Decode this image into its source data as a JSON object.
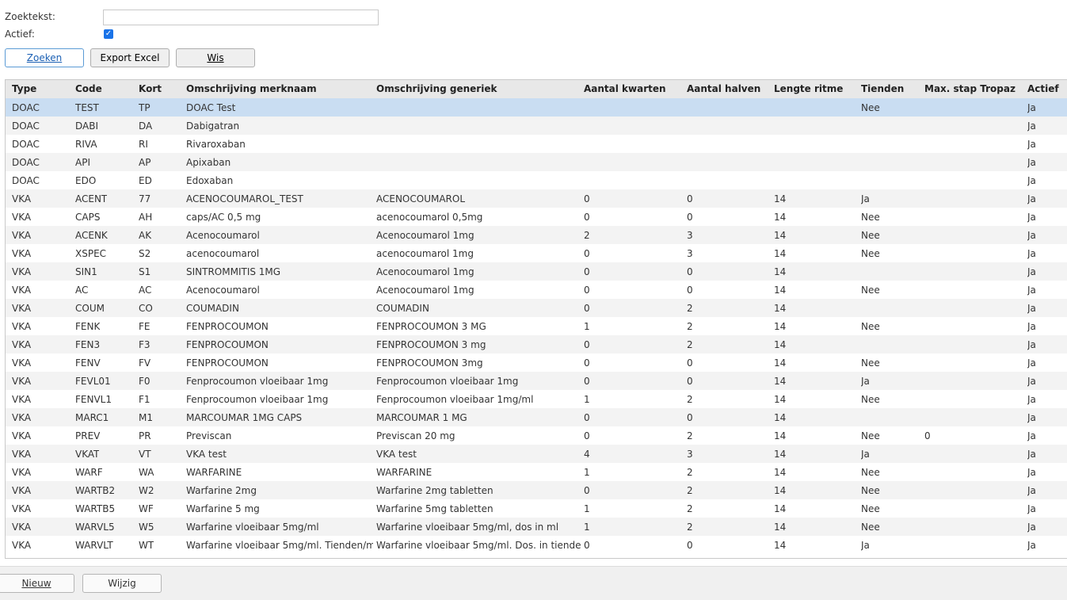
{
  "form": {
    "search_label": "Zoektekst:",
    "search_value": "",
    "active_label": "Actief:",
    "active_checked": true
  },
  "toolbar": {
    "search_button": "Zoeken",
    "export_button": "Export Excel",
    "clear_button": "Wis"
  },
  "table": {
    "columns": [
      "Type",
      "Code",
      "Kort",
      "Omschrijving merknaam",
      "Omschrijving generiek",
      "Aantal kwarten",
      "Aantal halven",
      "Lengte ritme",
      "Tienden",
      "Max. stap Tropaz",
      "Actief"
    ],
    "rows": [
      [
        "DOAC",
        "TEST",
        "TP",
        "DOAC Test",
        "",
        "",
        "",
        "",
        "Nee",
        "",
        "Ja"
      ],
      [
        "DOAC",
        "DABI",
        "DA",
        "Dabigatran",
        "",
        "",
        "",
        "",
        "",
        "",
        "Ja"
      ],
      [
        "DOAC",
        "RIVA",
        "RI",
        "Rivaroxaban",
        "",
        "",
        "",
        "",
        "",
        "",
        "Ja"
      ],
      [
        "DOAC",
        "API",
        "AP",
        "Apixaban",
        "",
        "",
        "",
        "",
        "",
        "",
        "Ja"
      ],
      [
        "DOAC",
        "EDO",
        "ED",
        "Edoxaban",
        "",
        "",
        "",
        "",
        "",
        "",
        "Ja"
      ],
      [
        "VKA",
        "ACENT",
        "77",
        "ACENOCOUMAROL_TEST",
        "ACENOCOUMAROL",
        "0",
        "0",
        "14",
        "Ja",
        "",
        "Ja"
      ],
      [
        "VKA",
        "CAPS",
        "AH",
        "caps/AC 0,5 mg",
        "acenocoumarol 0,5mg",
        "0",
        "0",
        "14",
        "Nee",
        "",
        "Ja"
      ],
      [
        "VKA",
        "ACENK",
        "AK",
        "Acenocoumarol",
        "Acenocoumarol 1mg",
        "2",
        "3",
        "14",
        "Nee",
        "",
        "Ja"
      ],
      [
        "VKA",
        "XSPEC",
        "S2",
        "acenocoumarol",
        "acenocoumarol 1mg",
        "0",
        "3",
        "14",
        "Nee",
        "",
        "Ja"
      ],
      [
        "VKA",
        "SIN1",
        "S1",
        "SINTROMMITIS 1MG",
        "Acenocoumarol 1mg",
        "0",
        "0",
        "14",
        "",
        "",
        "Ja"
      ],
      [
        "VKA",
        "AC",
        "AC",
        "Acenocoumarol",
        "Acenocoumarol 1mg",
        "0",
        "0",
        "14",
        "Nee",
        "",
        "Ja"
      ],
      [
        "VKA",
        "COUM",
        "CO",
        "COUMADIN",
        "COUMADIN",
        "0",
        "2",
        "14",
        "",
        "",
        "Ja"
      ],
      [
        "VKA",
        "FENK",
        "FE",
        "FENPROCOUMON",
        "FENPROCOUMON 3 MG",
        "1",
        "2",
        "14",
        "Nee",
        "",
        "Ja"
      ],
      [
        "VKA",
        "FEN3",
        "F3",
        "FENPROCOUMON",
        "FENPROCOUMON 3 mg",
        "0",
        "2",
        "14",
        "",
        "",
        "Ja"
      ],
      [
        "VKA",
        "FENV",
        "FV",
        "FENPROCOUMON",
        "FENPROCOUMON 3mg",
        "0",
        "0",
        "14",
        "Nee",
        "",
        "Ja"
      ],
      [
        "VKA",
        "FEVL01",
        "F0",
        "Fenprocoumon vloeibaar 1mg",
        "Fenprocoumon vloeibaar 1mg",
        "0",
        "0",
        "14",
        "Ja",
        "",
        "Ja"
      ],
      [
        "VKA",
        "FENVL1",
        "F1",
        "Fenprocoumon vloeibaar 1mg",
        "Fenprocoumon vloeibaar 1mg/ml",
        "1",
        "2",
        "14",
        "Nee",
        "",
        "Ja"
      ],
      [
        "VKA",
        "MARC1",
        "M1",
        "MARCOUMAR 1MG CAPS",
        "MARCOUMAR 1 MG",
        "0",
        "0",
        "14",
        "",
        "",
        "Ja"
      ],
      [
        "VKA",
        "PREV",
        "PR",
        "Previscan",
        "Previscan 20 mg",
        "0",
        "2",
        "14",
        "Nee",
        "0",
        "Ja"
      ],
      [
        "VKA",
        "VKAT",
        "VT",
        "VKA test",
        "VKA test",
        "4",
        "3",
        "14",
        "Ja",
        "",
        "Ja"
      ],
      [
        "VKA",
        "WARF",
        "WA",
        "WARFARINE",
        "WARFARINE",
        "1",
        "2",
        "14",
        "Nee",
        "",
        "Ja"
      ],
      [
        "VKA",
        "WARTB2",
        "W2",
        "Warfarine 2mg",
        "Warfarine 2mg tabletten",
        "0",
        "2",
        "14",
        "Nee",
        "",
        "Ja"
      ],
      [
        "VKA",
        "WARTB5",
        "WF",
        "Warfarine 5 mg",
        "Warfarine 5mg tabletten",
        "1",
        "2",
        "14",
        "Nee",
        "",
        "Ja"
      ],
      [
        "VKA",
        "WARVL5",
        "W5",
        "Warfarine vloeibaar 5mg/ml",
        "Warfarine vloeibaar 5mg/ml, dos in ml",
        "1",
        "2",
        "14",
        "Nee",
        "",
        "Ja"
      ],
      [
        "VKA",
        "WARVLT",
        "WT",
        "Warfarine vloeibaar 5mg/ml. Tienden/m",
        "Warfarine vloeibaar 5mg/ml. Dos. in tiender",
        "0",
        "0",
        "14",
        "Ja",
        "",
        "Ja"
      ]
    ]
  },
  "footer": {
    "new_button": "Nieuw",
    "edit_button": "Wijzig"
  },
  "colors": {
    "selected_row": "#c9ddf2",
    "checkbox": "#1a73e8"
  }
}
